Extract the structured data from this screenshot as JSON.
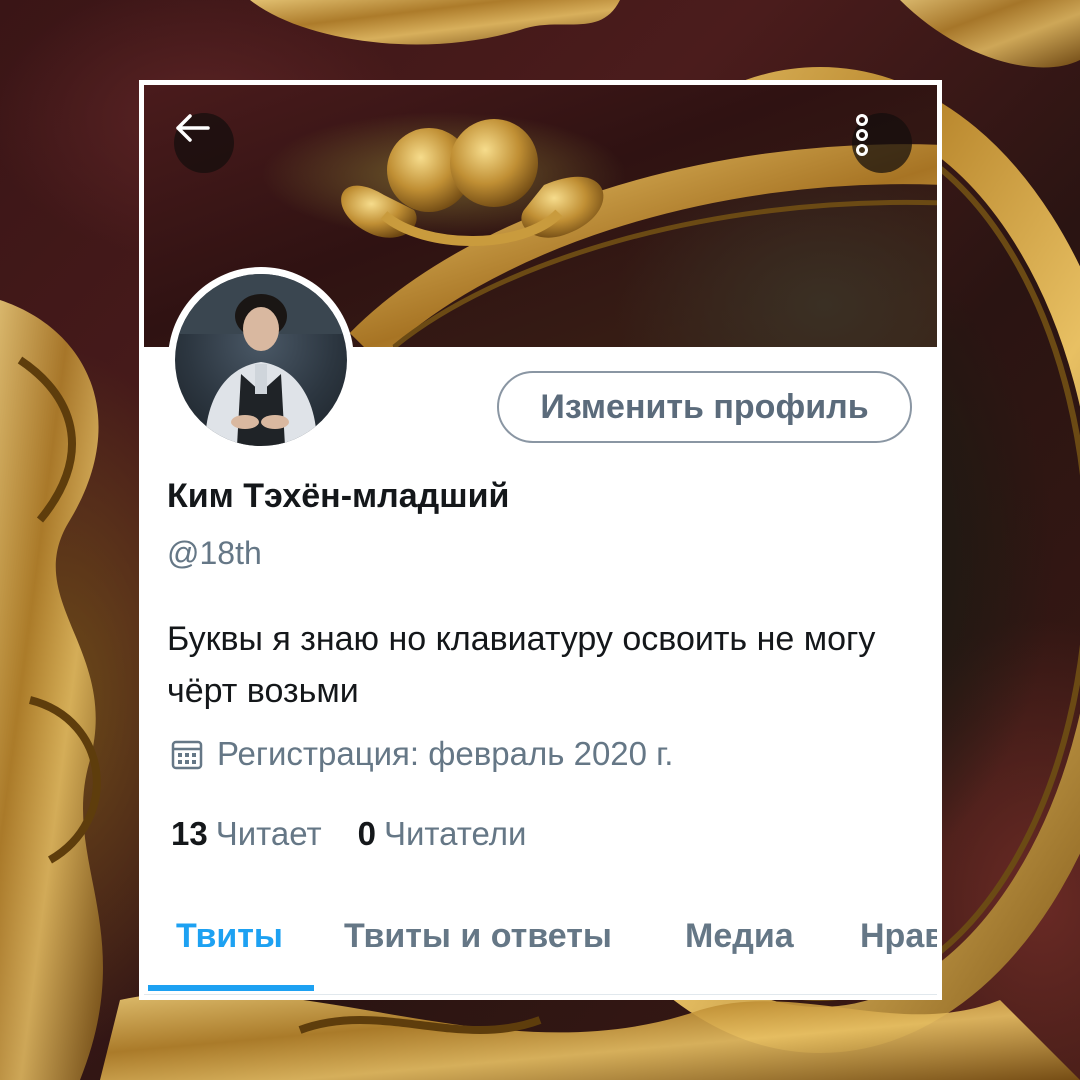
{
  "profile": {
    "edit_button_label": "Изменить профиль",
    "display_name": "Ким Тэхён-младший",
    "handle": "@18th",
    "bio": "Буквы я знаю но клавиатуру освоить не могу чёрт возьми",
    "joined": "Регистрация: февраль 2020 г.",
    "stats": [
      {
        "count": "13",
        "label": "Читает"
      },
      {
        "count": "0",
        "label": "Читатели"
      }
    ]
  },
  "tabs": [
    {
      "label": "Твиты",
      "active": true
    },
    {
      "label": "Твиты и ответы",
      "active": false
    },
    {
      "label": "Медиа",
      "active": false
    },
    {
      "label": "Нравится",
      "active": false
    }
  ],
  "icons": {
    "back": "arrow-left-icon",
    "more": "vertical-dots-icon",
    "joined": "calendar-icon"
  },
  "colors": {
    "accent": "#1da1f2",
    "secondary_text": "#657786",
    "primary_text": "#14171a"
  }
}
